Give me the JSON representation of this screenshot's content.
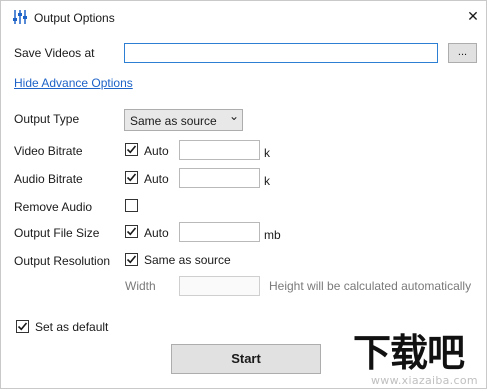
{
  "window": {
    "title": "Output Options",
    "close_glyph": "✕"
  },
  "save_videos": {
    "label": "Save Videos at",
    "value": "",
    "browse_label": "..."
  },
  "advanced_link": "Hide Advance Options",
  "output_type": {
    "label": "Output Type",
    "selected": "Same as source",
    "chevron": "⌄"
  },
  "video_bitrate": {
    "label": "Video Bitrate",
    "auto_checked": true,
    "auto_label": "Auto",
    "value": "",
    "unit": "k"
  },
  "audio_bitrate": {
    "label": "Audio Bitrate",
    "auto_checked": true,
    "auto_label": "Auto",
    "value": "",
    "unit": "k"
  },
  "remove_audio": {
    "label": "Remove Audio",
    "checked": false
  },
  "output_file_size": {
    "label": "Output File Size",
    "auto_checked": true,
    "auto_label": "Auto",
    "value": "",
    "unit": "mb"
  },
  "output_resolution": {
    "label": "Output Resolution",
    "same_checked": true,
    "same_label": "Same as source",
    "width_label": "Width",
    "width_value": "",
    "height_note": "Height will be calculated automatically"
  },
  "set_default": {
    "label": "Set as default",
    "checked": true
  },
  "start_button": "Start",
  "watermark": {
    "logo_text": "下载吧",
    "url": "www.xiazaiba.com"
  },
  "colors": {
    "link": "#1e63c8",
    "focus_border": "#2d7fd3",
    "button_bg": "#e1e1e1"
  }
}
